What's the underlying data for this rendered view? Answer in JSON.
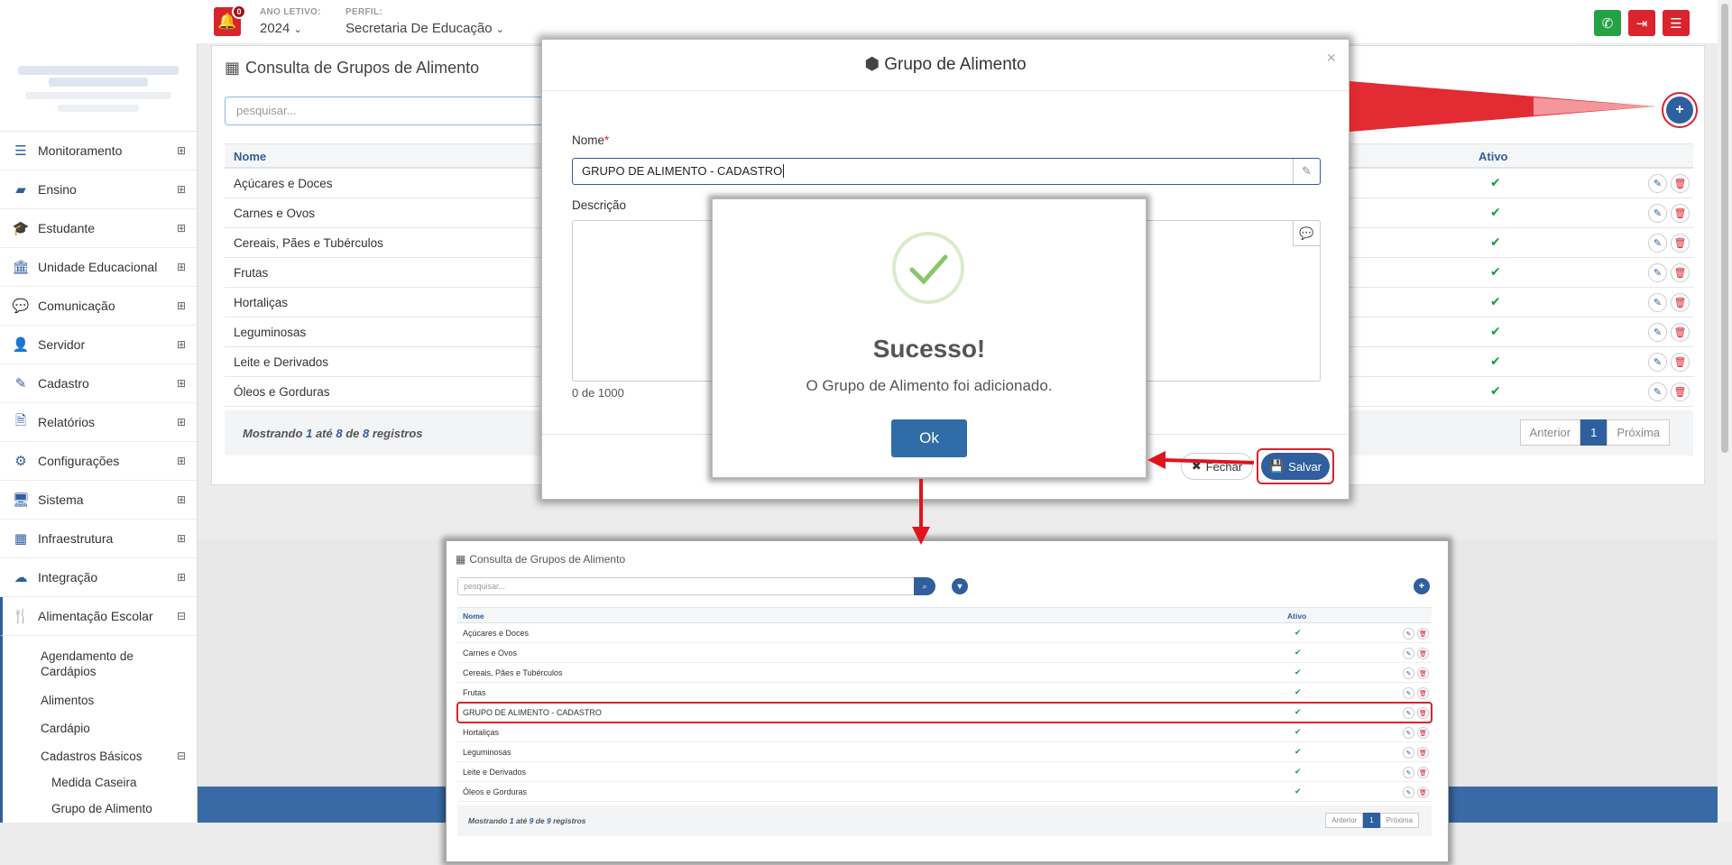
{
  "topbar": {
    "notifications_count": "0",
    "ano_letivo_label": "ANO LETIVO:",
    "ano_letivo_value": "2024",
    "perfil_label": "PERFIL:",
    "perfil_value": "Secretaria De Educação",
    "buttons": [
      {
        "icon": "whatsapp-icon",
        "color": "#25a244"
      },
      {
        "icon": "logout-icon",
        "color": "#d9232d"
      },
      {
        "icon": "menu-icon",
        "color": "#d9232d"
      }
    ]
  },
  "sidebar": {
    "items": [
      {
        "label": "Monitoramento",
        "icon": "sliders-icon",
        "toggle": "⊞"
      },
      {
        "label": "Ensino",
        "icon": "book-icon",
        "toggle": "⊞"
      },
      {
        "label": "Estudante",
        "icon": "graduation-cap-icon",
        "toggle": "⊞"
      },
      {
        "label": "Unidade Educacional",
        "icon": "institution-icon",
        "toggle": "⊞"
      },
      {
        "label": "Comunicação",
        "icon": "chat-icon",
        "toggle": "⊞"
      },
      {
        "label": "Servidor",
        "icon": "user-icon",
        "toggle": "⊞"
      },
      {
        "label": "Cadastro",
        "icon": "edit-icon",
        "toggle": "⊞"
      },
      {
        "label": "Relatórios",
        "icon": "file-icon",
        "toggle": "⊞"
      },
      {
        "label": "Configurações",
        "icon": "gear-icon",
        "toggle": "⊞"
      },
      {
        "label": "Sistema",
        "icon": "monitor-icon",
        "toggle": "⊞"
      },
      {
        "label": "Infraestrutura",
        "icon": "building-icon",
        "toggle": "⊞"
      },
      {
        "label": "Integração",
        "icon": "cloud-icon",
        "toggle": "⊞"
      },
      {
        "label": "Alimentação Escolar",
        "icon": "cutlery-icon",
        "toggle": "⊟"
      }
    ],
    "sub_items": [
      "Agendamento de Cardápios",
      "Alimentos",
      "Cardápio"
    ],
    "cadastros_basicos": {
      "label": "Cadastros Básicos",
      "toggle": "⊟"
    },
    "sub_sub_items": [
      "Medida Caseira",
      "Grupo de Alimento"
    ]
  },
  "main": {
    "title": "Consulta de Grupos de Alimento",
    "search_placeholder": "pesquisar...",
    "col_nome": "Nome",
    "col_ativo": "Ativo",
    "rows": [
      "Açúcares e Doces",
      "Carnes e Ovos",
      "Cereais, Pães e Tubérculos",
      "Frutas",
      "Hortaliças",
      "Leguminosas",
      "Leite e Derivados",
      "Óleos e Gorduras"
    ],
    "footer": {
      "prefix": "Mostrando",
      "from": "1",
      "ate": "até",
      "to": "8",
      "de": "de",
      "total": "8",
      "suffix": "registros"
    },
    "pager": {
      "prev": "Anterior",
      "page": "1",
      "next": "Próxima"
    }
  },
  "modal": {
    "title": "Grupo de Alimento",
    "close": "×",
    "nome_label": "Nome",
    "required_mark": "*",
    "nome_value": "GRUPO DE ALIMENTO - CADASTRO",
    "descricao_label": "Descrição",
    "char_count": "0 de 1000",
    "fechar": "Fechar",
    "salvar": "Salvar"
  },
  "success": {
    "heading": "Sucesso!",
    "message": "O Grupo de Alimento foi adicionado.",
    "ok": "Ok"
  },
  "inset": {
    "title": "Consulta de Grupos de Alimento",
    "search_placeholder": "pesquisar...",
    "col_nome": "Nome",
    "col_ativo": "Ativo",
    "rows": [
      "Açúcares e Doces",
      "Carnes e Ovos",
      "Cereais, Pães e Tubérculos",
      "Frutas",
      "GRUPO DE ALIMENTO - CADASTRO",
      "Hortaliças",
      "Leguminosas",
      "Leite e Derivados",
      "Óleos e Gorduras"
    ],
    "highlight_row": "GRUPO DE ALIMENTO - CADASTRO",
    "footer": {
      "prefix": "Mostrando",
      "from": "1",
      "ate": "até",
      "to": "9",
      "de": "de",
      "total": "9",
      "suffix": "registros"
    },
    "pager": {
      "prev": "Anterior",
      "page": "1",
      "next": "Próxima"
    }
  },
  "colors": {
    "primary": "#2f5f9e",
    "danger": "#d9232d",
    "success": "#1a9a4a",
    "highlight": "#e0141e"
  }
}
